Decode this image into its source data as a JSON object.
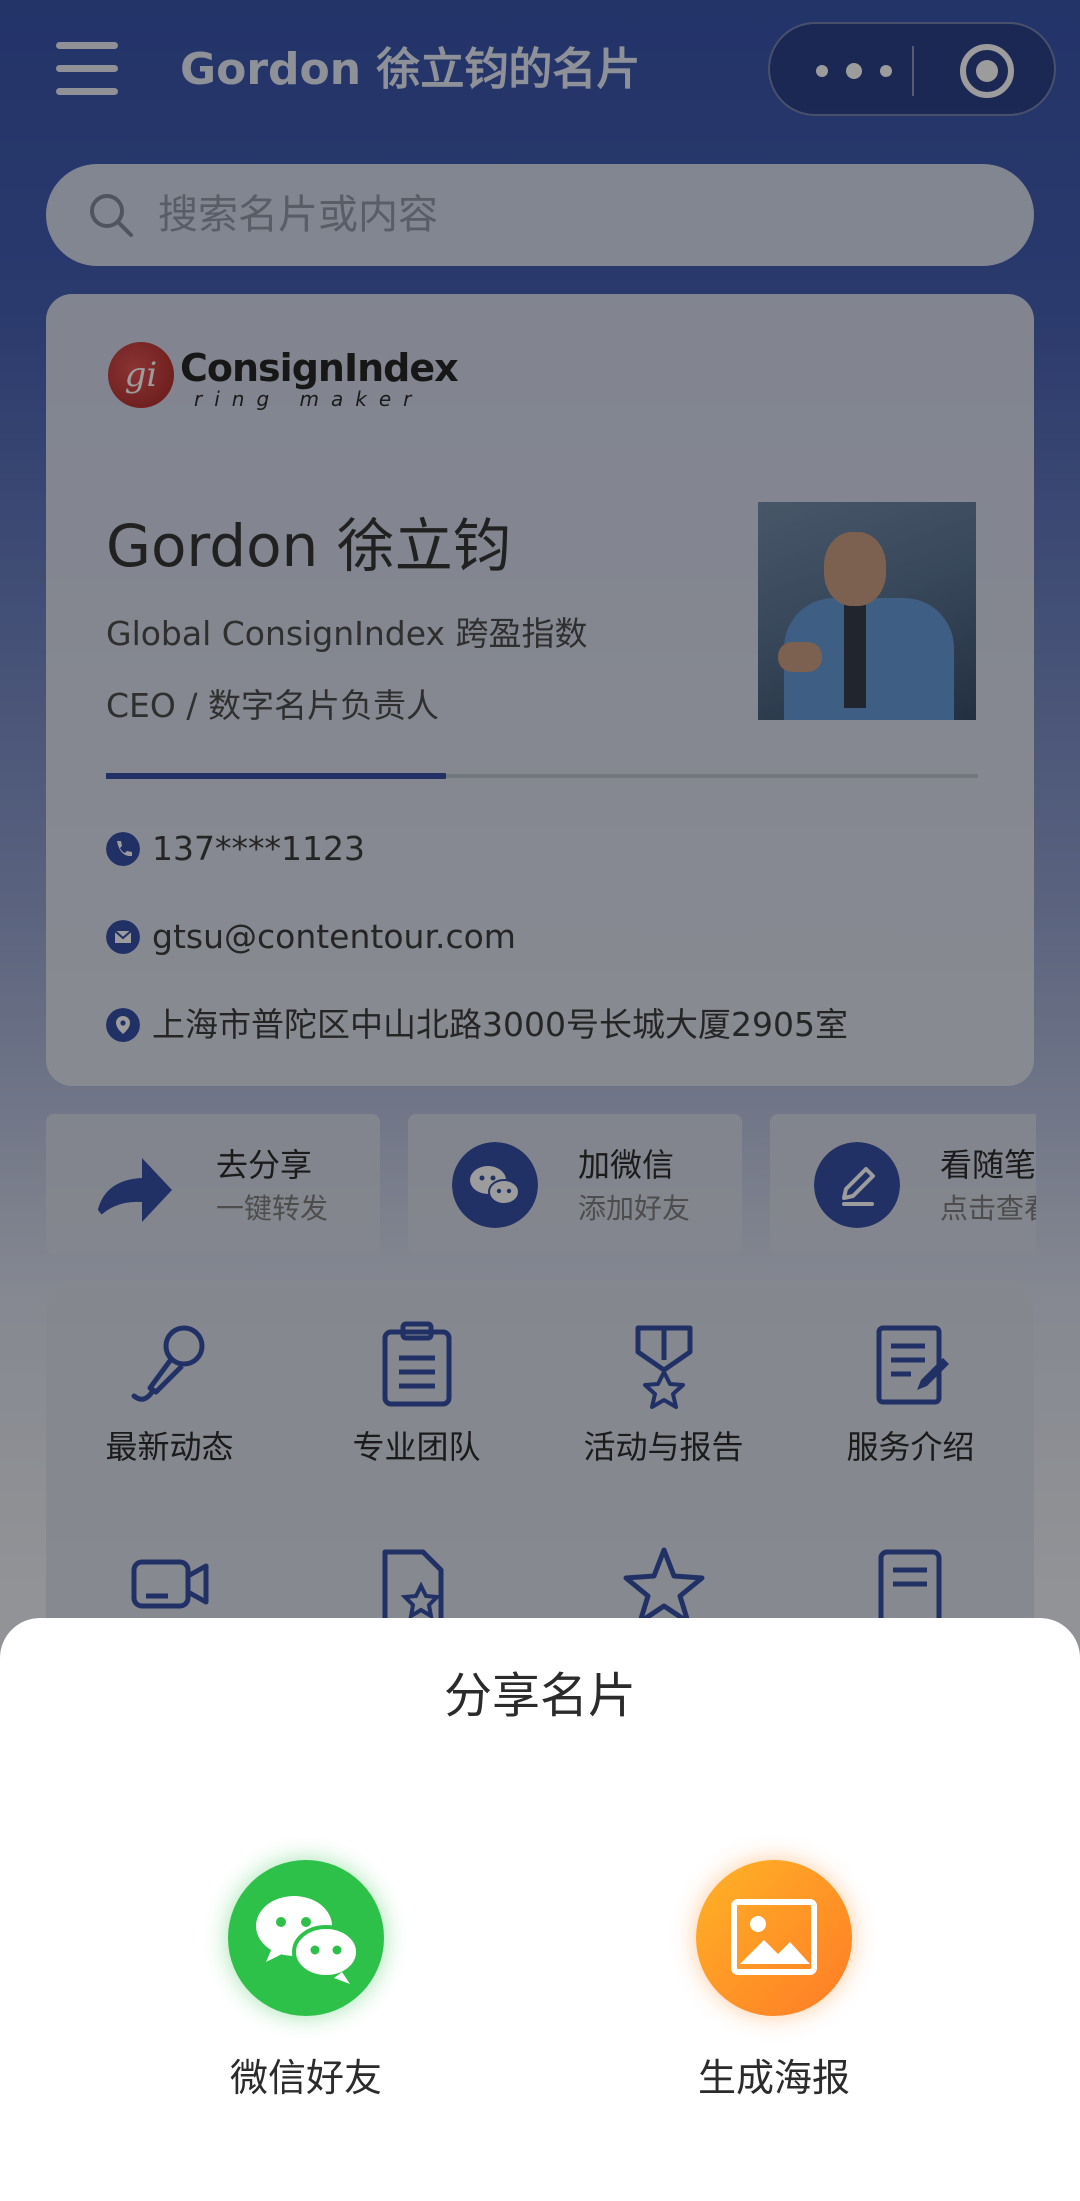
{
  "header": {
    "title": "Gordon 徐立钧的名片"
  },
  "search": {
    "placeholder": "搜索名片或内容"
  },
  "card": {
    "logo_letters": "gi",
    "logo_name": "ConsignIndex",
    "logo_tagline": "ring maker",
    "name": "Gordon 徐立钧",
    "company": "Global ConsignIndex 跨盈指数",
    "role": "CEO / 数字名片负责人",
    "progress_fraction": 0.39,
    "phone": "137****1123",
    "email": "gtsu@contentour.com",
    "address": "上海市普陀区中山北路3000号长城大厦2905室"
  },
  "actions": [
    {
      "title": "去分享",
      "subtitle": "一键转发",
      "icon": "share-arrow-icon"
    },
    {
      "title": "加微信",
      "subtitle": "添加好友",
      "icon": "wechat-icon"
    },
    {
      "title": "看随笔",
      "subtitle": "点击查看",
      "icon": "pen-icon"
    }
  ],
  "grid": [
    {
      "label": "最新动态",
      "icon": "microphone-icon"
    },
    {
      "label": "专业团队",
      "icon": "clipboard-icon"
    },
    {
      "label": "活动与报告",
      "icon": "medal-icon"
    },
    {
      "label": "服务介绍",
      "icon": "document-edit-icon"
    }
  ],
  "share_sheet": {
    "title": "分享名片",
    "options": [
      {
        "label": "微信好友",
        "icon": "wechat-icon",
        "color": "#2dc149"
      },
      {
        "label": "生成海报",
        "icon": "image-icon",
        "color": "#ff8c26"
      }
    ]
  },
  "colors": {
    "brand_blue": "#2b47a3",
    "overlay": "rgba(20,20,20,0.42)"
  }
}
